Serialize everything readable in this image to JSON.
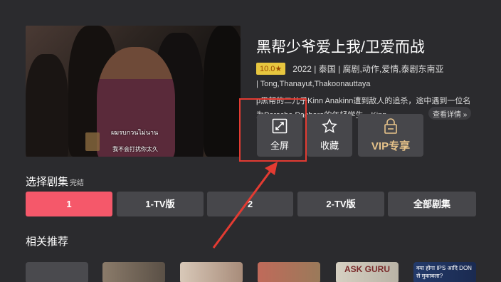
{
  "video": {
    "subtitle_thai": "ผมรบกวนไม่นาน",
    "subtitle_cn": "我不会打扰你太久"
  },
  "show": {
    "title": "黑帮少爷爱上我/卫爱而战",
    "rating": "10.0★",
    "info": "2022 | 泰国 | 腐剧,动作,爱情,泰剧东南亚",
    "cast": "| Tong,Thanayut,Thakoonauttaya",
    "description": "p黑帮的二儿子Kinn Anakinn遭到敌人的追杀，途中遇到一位名为Porsche Pachara的年轻学生。Kinn",
    "more_label": "查看详情 »"
  },
  "actions": {
    "fullscreen": {
      "label": "全屏",
      "icon": "fullscreen-icon"
    },
    "favorite": {
      "label": "收藏",
      "icon": "star-icon"
    },
    "vip": {
      "label": "VIP专享",
      "icon": "lock-icon"
    }
  },
  "episodes": {
    "heading": "选择剧集",
    "status": "完结",
    "items": [
      "1",
      "1-TV版",
      "2",
      "2-TV版",
      "全部剧集"
    ]
  },
  "related": {
    "heading": "相关推荐",
    "thumb5_text": "ASK GURU",
    "thumb6_text": "क्या होगा IPS आदि DON से मुकाबला?"
  },
  "colors": {
    "accent": "#f5586a",
    "highlight": "#e33b32",
    "gold": "#e7c38a"
  }
}
